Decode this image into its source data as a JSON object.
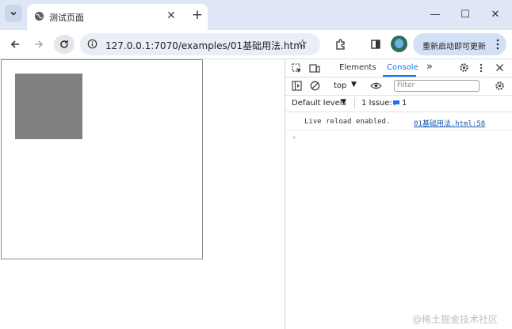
{
  "browser": {
    "tab_title": "测试页面",
    "tab_close_glyph": "✕",
    "new_tab_glyph": "+",
    "url": "127.0.0.1:7070/examples/01基础用法.html",
    "restart_button": "重新启动即可更新",
    "window_controls": [
      "—",
      "☐",
      "✕"
    ],
    "icons": [
      "tab-list-chevron-icon",
      "globe-icon",
      "back-arrow-icon",
      "forward-arrow-icon",
      "reload-icon",
      "site-info-icon",
      "star-icon",
      "extensions-icon",
      "side-panel-icon",
      "profile-avatar-icon",
      "more-vert-icon"
    ]
  },
  "devtools": {
    "tabs": [
      "Elements",
      "Console"
    ],
    "more_tabs_glyph": "»",
    "context": "top",
    "filter_placeholder": "Filter",
    "levels": "Default levels",
    "issues_label": "1 Issue:",
    "issues_count": "1",
    "log_message": "Live reload enabled.",
    "log_source": "01基础用法.html:58",
    "prompt": "›"
  },
  "colors": {
    "titlebar": "#dfe7f6",
    "square": "#808080",
    "accent": "#1a73e8"
  },
  "watermark": "@稀土掘金技术社区"
}
